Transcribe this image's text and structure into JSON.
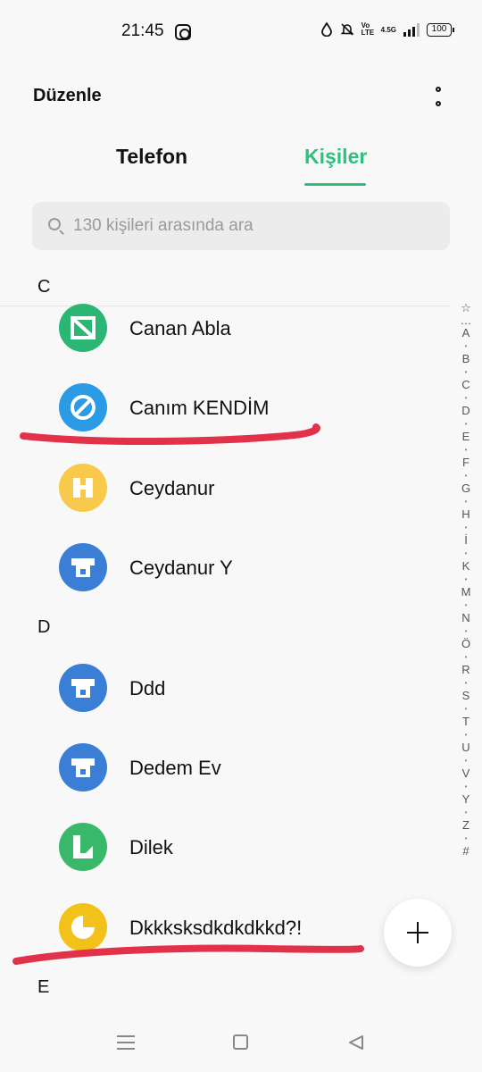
{
  "status_bar": {
    "time": "21:45",
    "network": "4.5G",
    "volte": "Vo LTE",
    "battery": "100"
  },
  "header": {
    "edit_label": "Düzenle",
    "more_icon": "more-vertical-icon"
  },
  "tabs": [
    {
      "label": "Telefon",
      "active": false
    },
    {
      "label": "Kişiler",
      "active": true
    }
  ],
  "search": {
    "placeholder": "130 kişileri arasında ara"
  },
  "sections": [
    {
      "letter": "C",
      "contacts": [
        {
          "name": "Canan Abla",
          "avatar_color": "#2bb673"
        },
        {
          "name": "Canım KENDİM",
          "avatar_color": "#2b9be6"
        },
        {
          "name": "Ceydanur",
          "avatar_color": "#f8c94a"
        },
        {
          "name": "Ceydanur Y",
          "avatar_color": "#3a7fd5"
        }
      ]
    },
    {
      "letter": "D",
      "contacts": [
        {
          "name": "Ddd",
          "avatar_color": "#3a7fd5"
        },
        {
          "name": "Dedem Ev",
          "avatar_color": "#3a7fd5"
        },
        {
          "name": "Dilek",
          "avatar_color": "#39b86a"
        },
        {
          "name": "Dkkksksdkdkdkkd?!",
          "avatar_color": "#f2c21b"
        }
      ]
    },
    {
      "letter": "E",
      "contacts": []
    }
  ],
  "alpha_index": [
    "☆",
    "…",
    "A",
    "B",
    "C",
    "D",
    "E",
    "F",
    "G",
    "H",
    "İ",
    "K",
    "M",
    "N",
    "Ö",
    "R",
    "S",
    "T",
    "U",
    "V",
    "Y",
    "Z",
    "#"
  ],
  "fab": {
    "icon": "plus-icon"
  },
  "nav": {
    "menu_icon": "menu-icon",
    "home_icon": "home-square-icon",
    "back_icon": "back-triangle-icon"
  },
  "colors": {
    "accent": "#2fbf7f",
    "annotation": "#e2324a"
  }
}
